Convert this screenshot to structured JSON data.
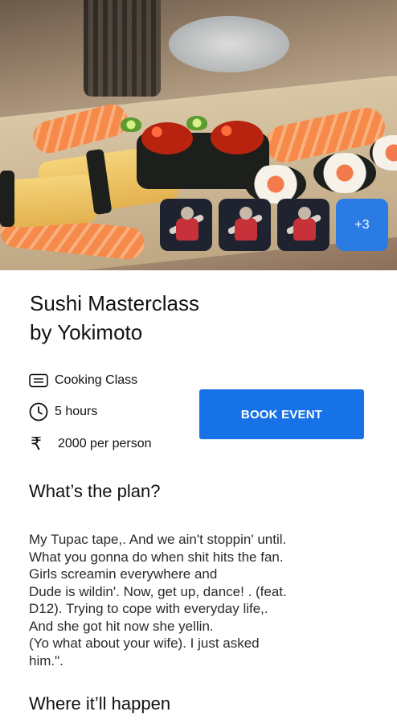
{
  "hero": {
    "thumbnails": [
      "dancer-photo",
      "dancer-photo",
      "dancer-photo"
    ],
    "more_count": "+3"
  },
  "event": {
    "title_line1": "Sushi Masterclass",
    "title_line2": "by Yokimoto",
    "category": "Cooking Class",
    "duration": "5 hours",
    "price": "2000 per person",
    "book_label": "BOOK EVENT",
    "accent_color": "#1672e6"
  },
  "plan": {
    "heading": "What’s the plan?",
    "lines": [
      "My Tupac tape,. And we ain't stoppin' until.",
      "What you gonna do when shit hits the fan.",
      "Girls screamin everywhere and",
      "Dude is wildin'. Now, get up, dance! . (feat.",
      "D12). Trying to cope with everyday life,.",
      "And she got hit now she yellin.",
      "(Yo what about your wife). I just asked",
      "him.\"."
    ]
  },
  "location": {
    "heading": "Where it’ll happen"
  },
  "icons": {
    "category": "ticket-icon",
    "duration": "clock-icon",
    "price": "rupee-icon"
  }
}
